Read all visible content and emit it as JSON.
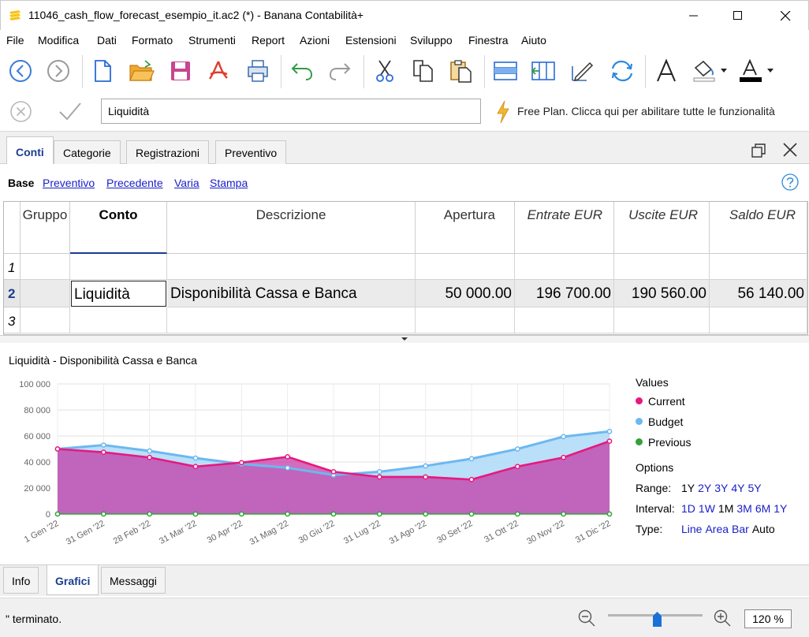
{
  "window": {
    "title": "11046_cash_flow_forecast_esempio_it.ac2 (*) - Banana Contabilità+"
  },
  "menu": [
    "File",
    "Modifica",
    "Dati",
    "Formato",
    "Strumenti",
    "Report",
    "Azioni",
    "Estensioni",
    "Sviluppo",
    "Finestra",
    "Aiuto"
  ],
  "toolbar": {
    "icons": [
      "back-icon",
      "forward-icon",
      "new-file-icon",
      "open-folder-icon",
      "save-icon",
      "pdf-icon",
      "print-icon",
      "undo-icon",
      "redo-icon",
      "cut-icon",
      "copy-icon",
      "paste-icon",
      "insert-rows-icon",
      "add-column-icon",
      "edit-icon",
      "refresh-icon",
      "font-icon",
      "fill-color-icon",
      "text-color-icon"
    ]
  },
  "editrow": {
    "cell_value": "Liquidità",
    "freeplan": "Free Plan. Clicca qui per abilitare tutte le funzionalità"
  },
  "tabs": [
    "Conti",
    "Categorie",
    "Registrazioni",
    "Preventivo"
  ],
  "views": {
    "active": "Base",
    "links": [
      "Preventivo",
      "Precedente",
      "Varia",
      "Stampa"
    ]
  },
  "table": {
    "headers": {
      "gruppo": "Gruppo",
      "conto": "Conto",
      "descrizione": "Descrizione",
      "apertura": "Apertura",
      "entrate": "Entrate EUR",
      "uscite": "Uscite EUR",
      "saldo": "Saldo EUR"
    },
    "rows": [
      {
        "num": "1",
        "conto": "",
        "descrizione": "",
        "apertura": "",
        "entrate": "",
        "uscite": "",
        "saldo": ""
      },
      {
        "num": "2",
        "conto": "Liquidità",
        "descrizione": "Disponibilità Cassa e Banca",
        "apertura": "50 000.00",
        "entrate": "196 700.00",
        "uscite": "190 560.00",
        "saldo": "56 140.00"
      },
      {
        "num": "3",
        "conto": "",
        "descrizione": "",
        "apertura": "",
        "entrate": "",
        "uscite": "",
        "saldo": ""
      }
    ]
  },
  "chart_title": "Liquidità - Disponibilità Cassa e Banca",
  "chart_data": {
    "type": "area",
    "title": "Liquidità - Disponibilità Cassa e Banca",
    "categories": [
      "1 Gen '22",
      "31 Gen '22",
      "28 Feb '22",
      "31 Mar '22",
      "30 Apr '22",
      "31 Mag '22",
      "30 Giu '22",
      "31 Lug '22",
      "31 Ago '22",
      "30 Set '22",
      "31 Ott '22",
      "30 Nov '22",
      "31 Dic '22"
    ],
    "y_ticks": [
      "100 000",
      "80 000",
      "60 000",
      "40 000",
      "20 000",
      "0"
    ],
    "ylim": [
      0,
      100000
    ],
    "series": [
      {
        "name": "Current",
        "color": "#e6197f",
        "values": [
          50000,
          47500,
          43500,
          36500,
          39500,
          44000,
          32500,
          28500,
          28500,
          26500,
          36500,
          43500,
          56000
        ]
      },
      {
        "name": "Budget",
        "color": "#6cb8f0",
        "values": [
          50000,
          53000,
          48500,
          43000,
          38500,
          35500,
          30000,
          32500,
          37000,
          42500,
          50000,
          59500,
          63500
        ]
      },
      {
        "name": "Previous",
        "color": "#33a03c",
        "values": [
          0,
          0,
          0,
          0,
          0,
          0,
          0,
          0,
          0,
          0,
          0,
          0,
          0
        ]
      }
    ],
    "grid": true
  },
  "legend": {
    "values_title": "Values",
    "series": [
      {
        "label": "Current",
        "color": "#e6197f"
      },
      {
        "label": "Budget",
        "color": "#6cb8f0"
      },
      {
        "label": "Previous",
        "color": "#33a03c"
      }
    ],
    "options_title": "Options",
    "range_label": "Range:",
    "range": [
      {
        "t": "1Y",
        "sel": true
      },
      {
        "t": "2Y"
      },
      {
        "t": "3Y"
      },
      {
        "t": "4Y"
      },
      {
        "t": "5Y"
      }
    ],
    "interval_label": "Interval:",
    "interval": [
      {
        "t": "1D"
      },
      {
        "t": "1W"
      },
      {
        "t": "1M",
        "sel": true
      },
      {
        "t": "3M"
      },
      {
        "t": "6M"
      },
      {
        "t": "1Y"
      }
    ],
    "type_label": "Type:",
    "type": [
      {
        "t": "Line"
      },
      {
        "t": "Area"
      },
      {
        "t": "Bar"
      },
      {
        "t": "Auto",
        "sel": true
      }
    ]
  },
  "bottomtabs": [
    "Info",
    "Grafici",
    "Messaggi"
  ],
  "status": {
    "text": "\" terminato.",
    "zoom": "120 %",
    "zoom_slider": 0.52
  }
}
